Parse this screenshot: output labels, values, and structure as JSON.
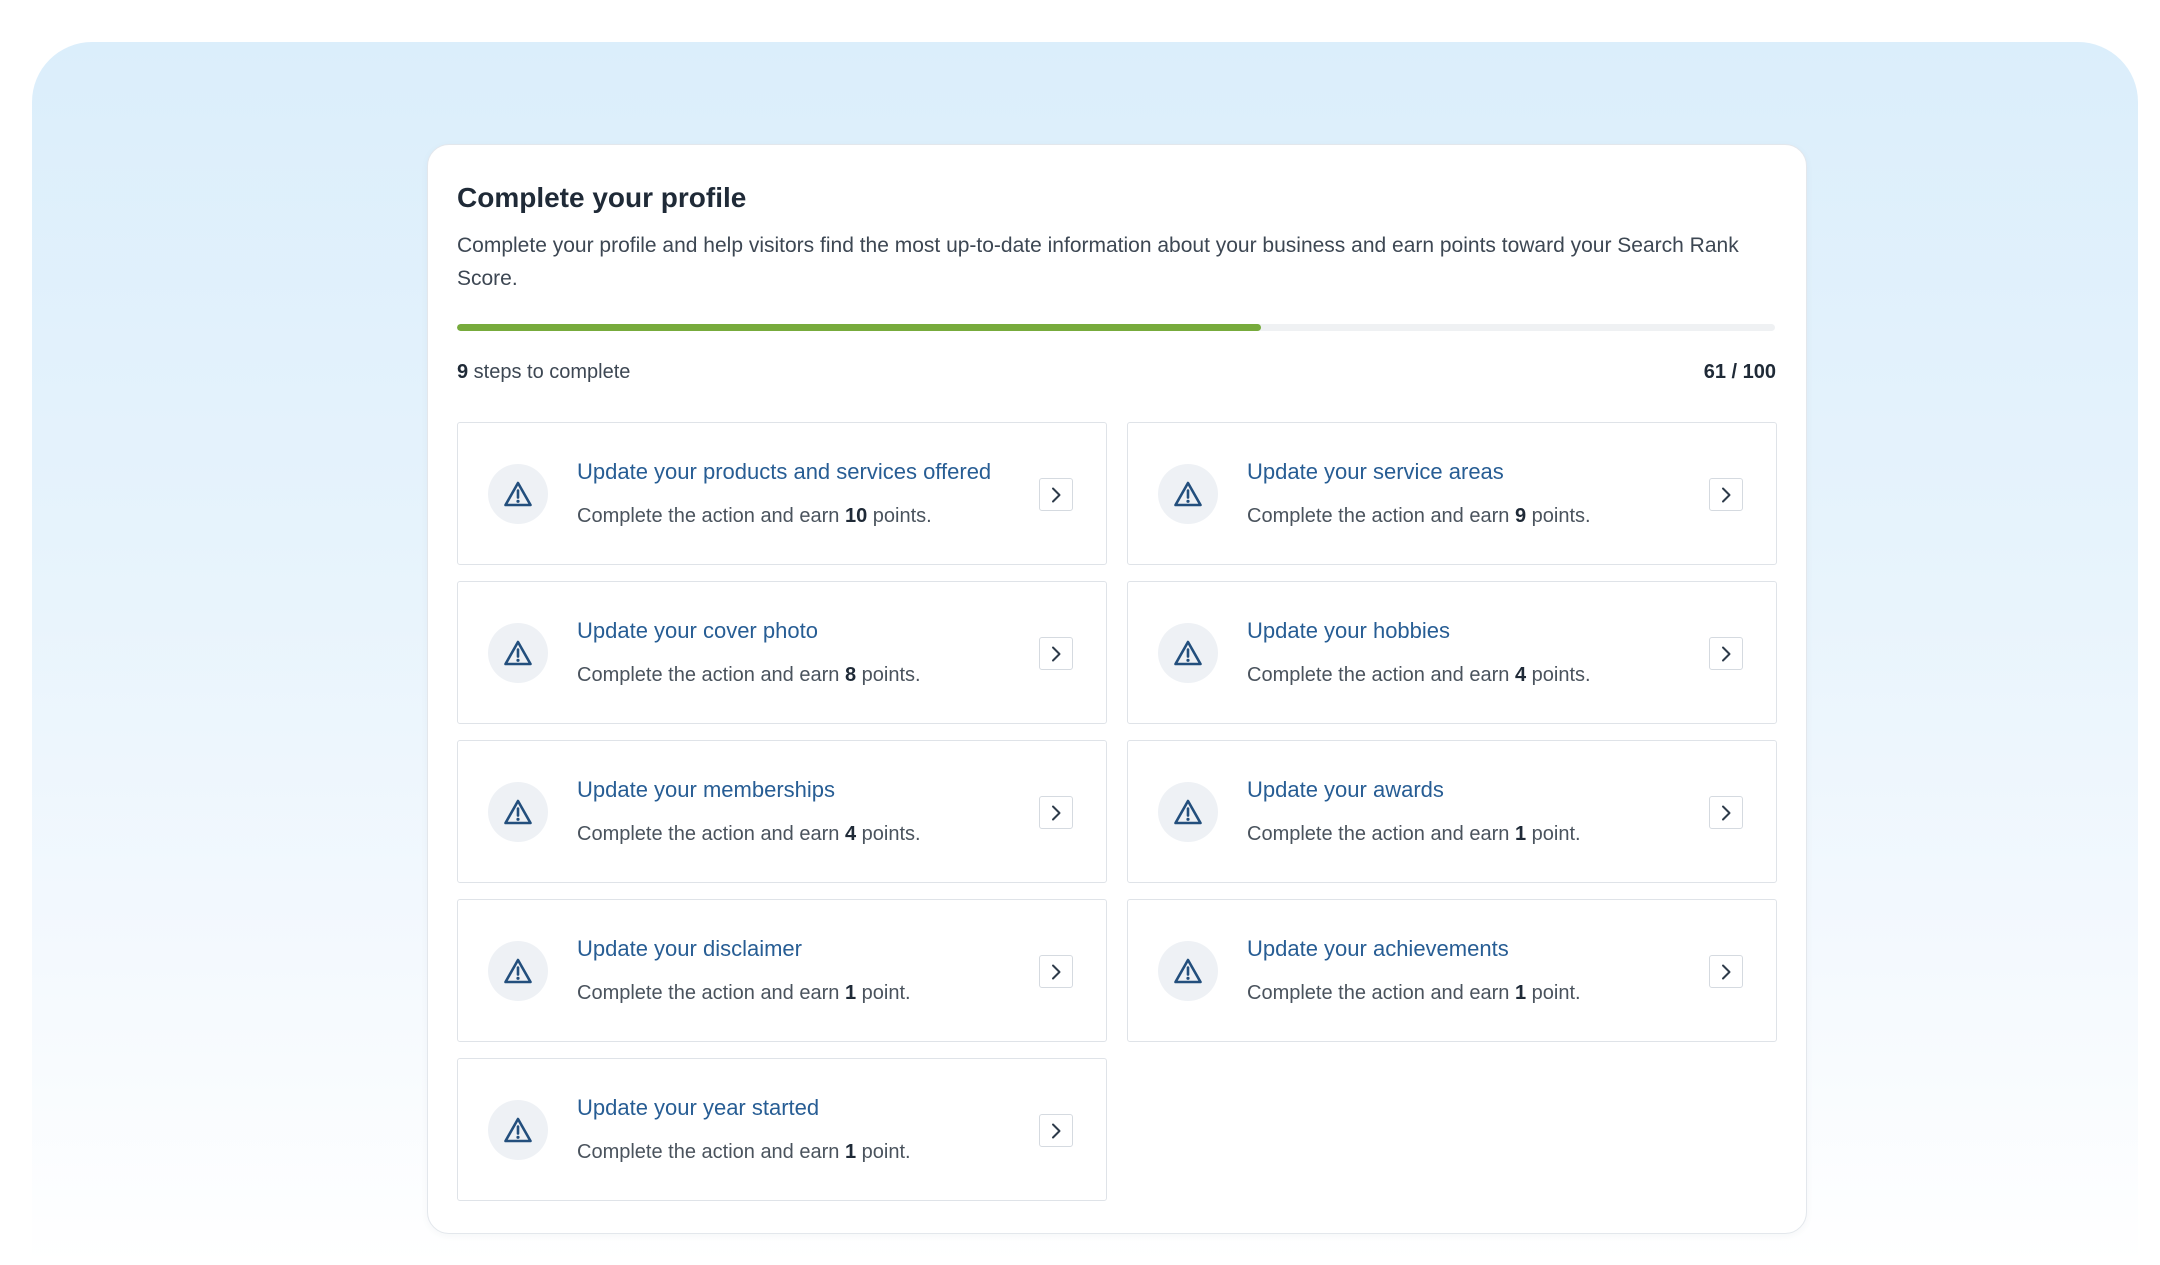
{
  "profile": {
    "title": "Complete your profile",
    "description": "Complete your profile and help visitors find the most up-to-date information about your business and earn points toward your Search Rank Score.",
    "progress": {
      "current": 61,
      "max": 100,
      "fraction": 0.61,
      "bar_color": "#77ab3c",
      "steps_remaining": "9",
      "steps_suffix": " steps to complete",
      "score_label": "61 / 100"
    },
    "task_prefix": "Complete the action and earn ",
    "tasks": [
      {
        "title": "Update your products and services offered",
        "points": "10",
        "unit": " points."
      },
      {
        "title": "Update your service areas",
        "points": "9",
        "unit": " points."
      },
      {
        "title": "Update your cover photo",
        "points": "8",
        "unit": " points."
      },
      {
        "title": "Update your hobbies",
        "points": "4",
        "unit": " points."
      },
      {
        "title": "Update your memberships",
        "points": "4",
        "unit": " points."
      },
      {
        "title": "Update your awards",
        "points": "1",
        "unit": " point."
      },
      {
        "title": "Update your disclaimer",
        "points": "1",
        "unit": " point."
      },
      {
        "title": "Update your achievements",
        "points": "1",
        "unit": " point."
      },
      {
        "title": "Update your year started",
        "points": "1",
        "unit": " point."
      }
    ],
    "icons": {
      "status": "warning-triangle-icon",
      "action": "chevron-right-icon"
    },
    "colors": {
      "accent_text": "#275d94",
      "progress_fill": "#77ab3c"
    }
  }
}
